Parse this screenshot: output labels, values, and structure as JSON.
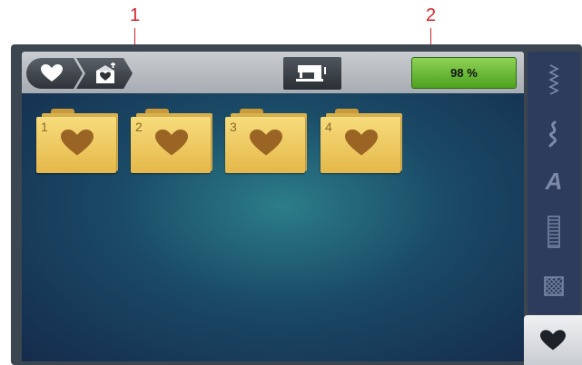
{
  "callouts": [
    {
      "label": "1"
    },
    {
      "label": "2"
    }
  ],
  "header": {
    "crumbs": [
      {
        "icon": "heart-icon"
      },
      {
        "icon": "heart-box-icon"
      }
    ],
    "machine_icon": "sewing-machine-icon",
    "status_label": "98 %"
  },
  "folders": [
    {
      "number": "1",
      "icon": "heart-icon"
    },
    {
      "number": "2",
      "icon": "heart-icon"
    },
    {
      "number": "3",
      "icon": "heart-icon"
    },
    {
      "number": "4",
      "icon": "heart-icon"
    }
  ],
  "sidebar": {
    "items": [
      {
        "icon": "practical-stitch-icon"
      },
      {
        "icon": "decorative-stitch-icon"
      },
      {
        "icon": "alphabet-icon",
        "glyph": "A"
      },
      {
        "icon": "buttonhole-icon"
      },
      {
        "icon": "quilt-stitch-icon"
      },
      {
        "icon": "personal-program-heart-icon",
        "active": true
      }
    ]
  },
  "colors": {
    "accent_green": "#6cbd33",
    "callout_red": "#d8232a",
    "folder_yellow": "#f2cf6a",
    "sidebar_blue": "#2d3b5c"
  }
}
